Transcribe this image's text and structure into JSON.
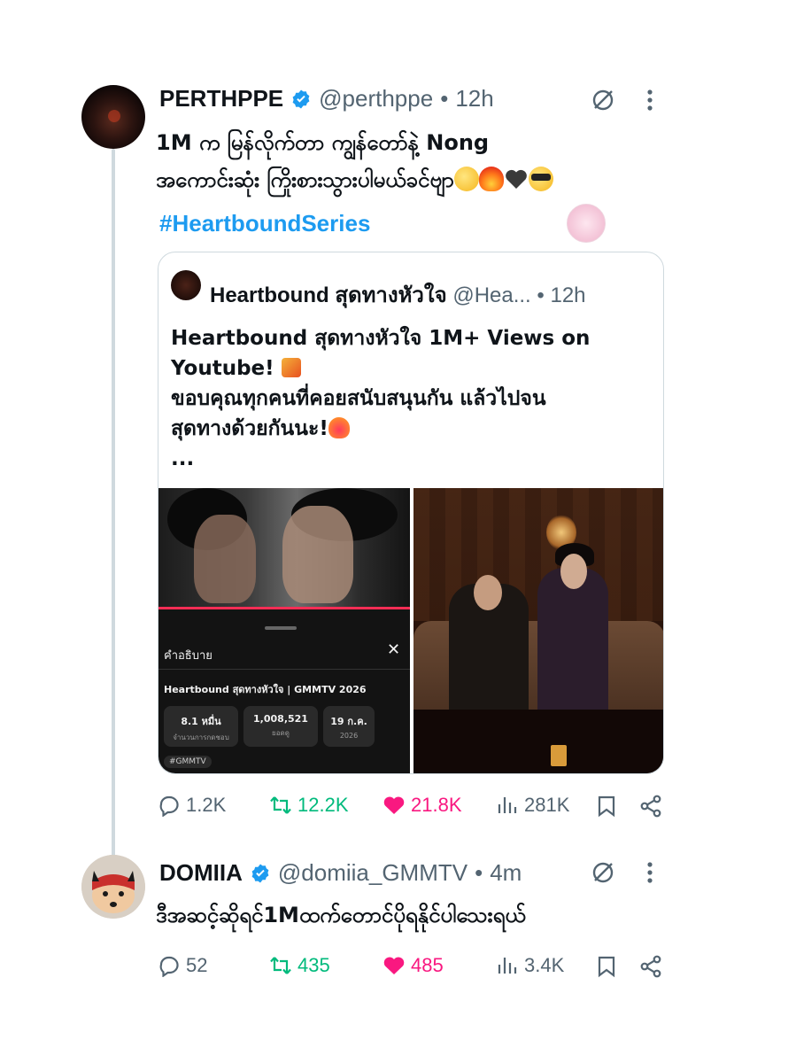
{
  "tweet1": {
    "display_name": "PERTHPPE",
    "handle": "@perthppe",
    "separator": "•",
    "time": "12h",
    "text_line1": "1M က မြန်လိုက်တာ ကျွန်တော်နဲ့ Nong",
    "text_line2": "အကောင်းဆုံး ကြိုးစားသွားပါမယ်ခင်ဗျာ",
    "line2_emojis": [
      "saluting-face",
      "fire",
      "black-heart",
      "smiling-face-with-sunglasses"
    ],
    "hashtag": "#HeartboundSeries",
    "actions": {
      "replies": "1.2K",
      "reposts": "12.2K",
      "likes": "21.8K",
      "views": "281K"
    }
  },
  "quote": {
    "display_name": "Heartbound สุดทางหัวใจ",
    "handle": "@Hea...",
    "separator": "•",
    "time": "12h",
    "text_line1": "Heartbound สุดทางหัวใจ 1M+ Views on",
    "text_line2": "Youtube!",
    "text_line3": "ขอบคุณทุกคนที่คอยสนับสนุนกัน แล้วไปจน",
    "text_line4": "สุดทางด้วยกันนะ!",
    "text_line5": "...",
    "video_panel": {
      "section_title": "คำอธิบาย",
      "close_glyph": "✕",
      "video_title": "Heartbound สุดทางหัวใจ | GMMTV 2026",
      "stats": [
        {
          "value": "8.1 หมื่น",
          "label": "จำนวนการกดชอบ"
        },
        {
          "value": "1,008,521",
          "label": "ยอดดู"
        },
        {
          "value": "19 ก.ค.",
          "label": "2026"
        }
      ],
      "tag": "#GMMTV"
    }
  },
  "tweet2": {
    "display_name": "DOMIIA",
    "handle": "@domiia_GMMTV",
    "separator": "•",
    "time": "4m",
    "text": "ဒီအဆင့်ဆိုရင်1Mထက်တောင်ပိုရနိုင်ပါသေးရယ်",
    "actions": {
      "replies": "52",
      "reposts": "435",
      "likes": "485",
      "views": "3.4K"
    }
  },
  "colors": {
    "verified": "#1d9bf0",
    "hashtag": "#1d9bf0",
    "retweet": "#00ba7c",
    "like": "#f91880",
    "muted": "#536471",
    "thread_line": "#cfd9de"
  },
  "icons": [
    "verified-badge",
    "grok-icon",
    "more-icon",
    "reply-icon",
    "retweet-icon",
    "like-icon",
    "views-icon",
    "bookmark-icon",
    "share-icon"
  ]
}
